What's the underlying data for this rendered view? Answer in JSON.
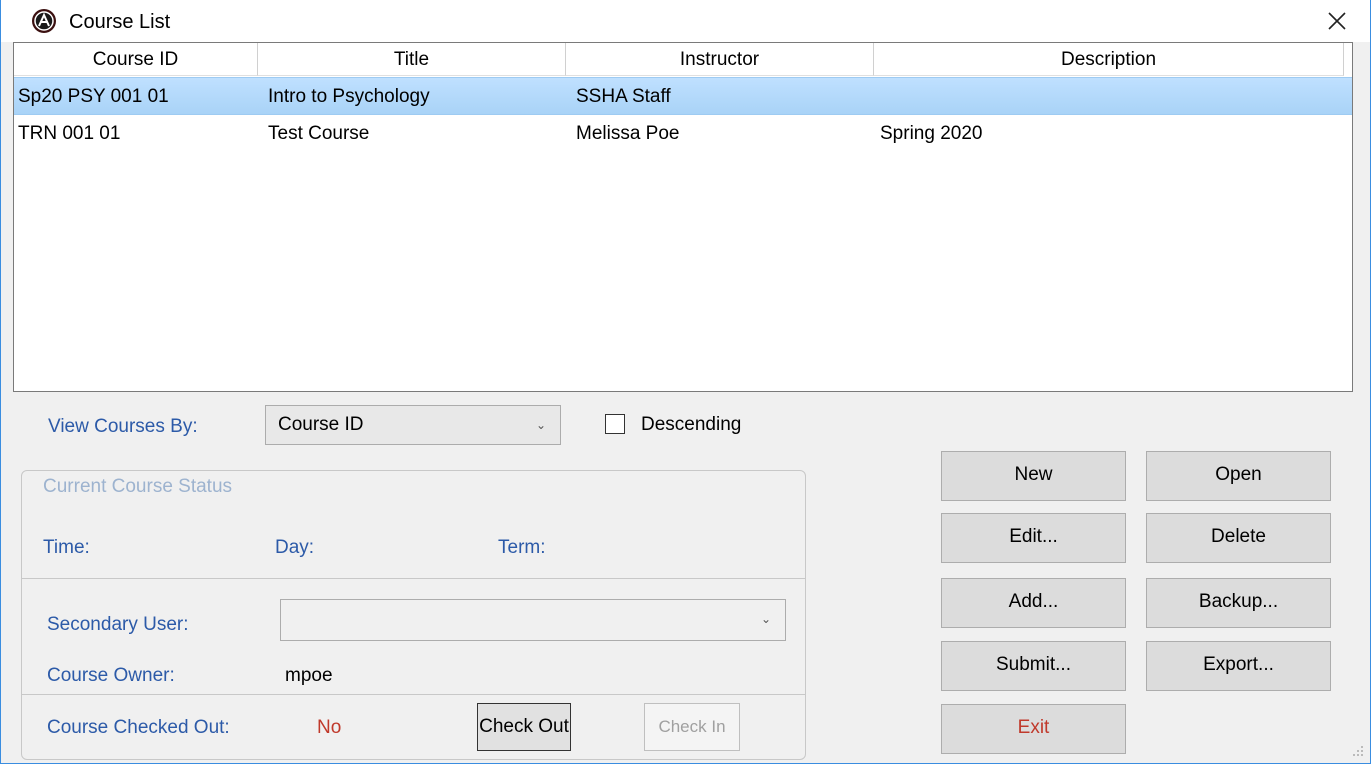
{
  "window": {
    "title": "Course List"
  },
  "list": {
    "columns": [
      "Course ID",
      "Title",
      "Instructor",
      "Description"
    ],
    "rows": [
      {
        "course_id": "Sp20 PSY 001 01",
        "title": "Intro to Psychology",
        "instructor": "SSHA Staff",
        "description": ""
      },
      {
        "course_id": "TRN 001 01",
        "title": "Test Course",
        "instructor": "Melissa Poe",
        "description": "Spring 2020"
      }
    ]
  },
  "view_by": {
    "label": "View Courses By:",
    "selected": "Course ID",
    "descending_label": "Descending",
    "descending_checked": false
  },
  "status": {
    "group_title": "Current Course Status",
    "time_label": "Time:",
    "day_label": "Day:",
    "term_label": "Term:",
    "secondary_user_label": "Secondary User:",
    "secondary_user_value": "",
    "owner_label": "Course Owner:",
    "owner_value": "mpoe",
    "checked_out_label": "Course Checked Out:",
    "checked_out_value": "No",
    "check_out_label": "Check Out",
    "check_in_label": "Check In"
  },
  "buttons": {
    "new": "New",
    "open": "Open",
    "edit": "Edit...",
    "delete": "Delete",
    "add": "Add...",
    "backup": "Backup...",
    "submit": "Submit...",
    "export": "Export...",
    "exit": "Exit"
  },
  "colors": {
    "label_blue": "#2c5aa8",
    "exit_red": "#c0392b",
    "no_red": "#c0392b",
    "selection": "#bfe0ff"
  }
}
